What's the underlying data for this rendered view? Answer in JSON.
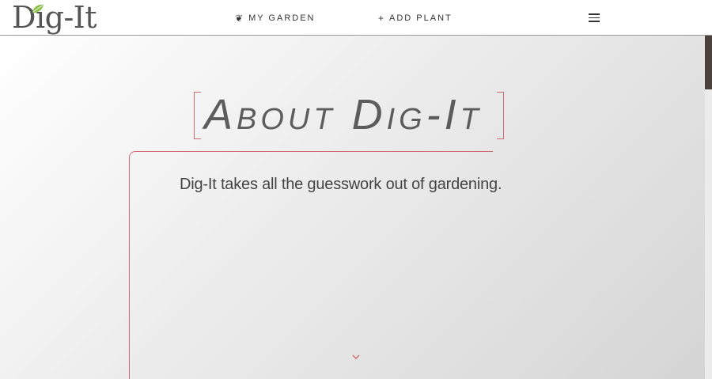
{
  "header": {
    "logo_text": "Dig-It",
    "nav": [
      {
        "icon": "plant-sprout-icon",
        "glyph": "❦",
        "label": "MY GARDEN"
      },
      {
        "icon": "plus-icon",
        "glyph": "+",
        "label": "ADD PLANT"
      }
    ],
    "menu_icon": "hamburger-menu-icon"
  },
  "hero": {
    "title": "About Dig-It",
    "tagline": "Dig-It takes all the guesswork out of gardening.",
    "scroll_icon": "chevron-down-icon"
  },
  "colors": {
    "accent": "#d06a72",
    "leaf": "#8cc04b",
    "text": "#444444",
    "scroll_thumb": "#4a413d"
  }
}
